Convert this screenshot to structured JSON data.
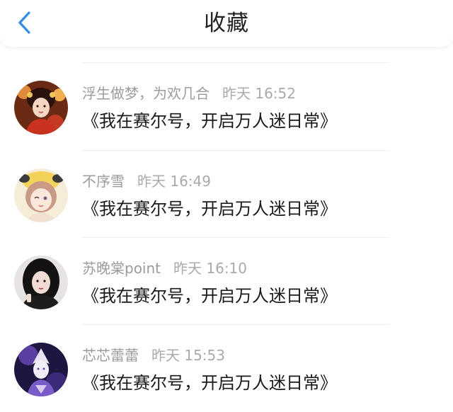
{
  "header": {
    "title": "收藏",
    "back_icon": "chevron-left-icon",
    "accent_color": "#2f8fe8"
  },
  "items": [
    {
      "username": "浮生做梦，为欢几合",
      "time": "昨天 16:52",
      "book": "《我在赛尔号，开启万人迷日常》",
      "avatar": "avatar-girl-red-costume"
    },
    {
      "username": "不序雪",
      "time": "昨天 16:49",
      "book": "《我在赛尔号，开启万人迷日常》",
      "avatar": "avatar-anime-girl-yellow-hat"
    },
    {
      "username": "苏晚棠point",
      "time": "昨天 16:10",
      "book": "《我在赛尔号，开启万人迷日常》",
      "avatar": "avatar-girl-dark-hair"
    },
    {
      "username": "芯芯蕾蕾",
      "time": "昨天 15:53",
      "book": "《我在赛尔号，开启万人迷日常》",
      "avatar": "avatar-anime-purple"
    }
  ]
}
